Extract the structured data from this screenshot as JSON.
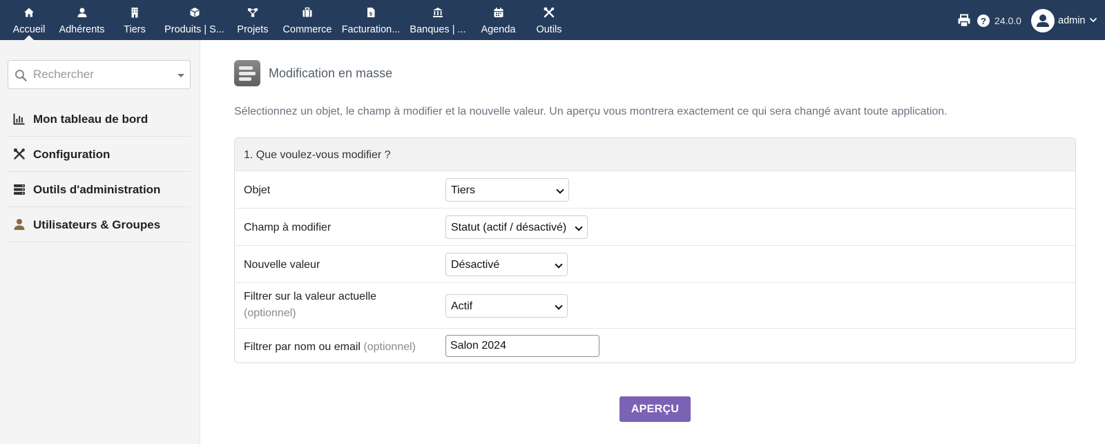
{
  "topnav": {
    "items": [
      {
        "label": "Accueil",
        "icon": "home-icon"
      },
      {
        "label": "Adhérents",
        "icon": "user-icon"
      },
      {
        "label": "Tiers",
        "icon": "building-icon"
      },
      {
        "label": "Produits | S...",
        "icon": "cube-icon"
      },
      {
        "label": "Projets",
        "icon": "project-icon"
      },
      {
        "label": "Commerce",
        "icon": "briefcase-icon"
      },
      {
        "label": "Facturation...",
        "icon": "invoice-icon"
      },
      {
        "label": "Banques | ...",
        "icon": "bank-icon"
      },
      {
        "label": "Agenda",
        "icon": "calendar-icon"
      },
      {
        "label": "Outils",
        "icon": "tools-icon"
      }
    ],
    "active": "Accueil",
    "version": "24.0.0",
    "user": "admin"
  },
  "sidebar": {
    "search_placeholder": "Rechercher",
    "items": [
      {
        "label": "Mon tableau de bord",
        "icon": "chart-icon"
      },
      {
        "label": "Configuration",
        "icon": "tools-icon"
      },
      {
        "label": "Outils d'administration",
        "icon": "server-icon"
      },
      {
        "label": "Utilisateurs & Groupes",
        "icon": "user-icon"
      }
    ]
  },
  "main": {
    "title": "Modification en masse",
    "description": "Sélectionnez un objet, le champ à modifier et la nouvelle valeur. Un aperçu vous montrera exactement ce qui sera changé avant toute application.",
    "section_title": "1. Que voulez-vous modifier ?",
    "fields": {
      "objet": {
        "label": "Objet",
        "value": "Tiers"
      },
      "champ": {
        "label": "Champ à modifier",
        "value": "Statut (actif / désactivé)"
      },
      "valeur": {
        "label": "Nouvelle valeur",
        "value": "Désactivé"
      },
      "filtre_valeur": {
        "label": "Filtrer sur la valeur actuelle",
        "optional": "(optionnel)",
        "value": "Actif"
      },
      "filtre_nom": {
        "label": "Filtrer par nom ou email",
        "optional": "(optionnel)",
        "value": "Salon 2024"
      }
    },
    "preview_button": "APERÇU"
  },
  "colors": {
    "topbar": "#263c5c",
    "button": "#7b62b5",
    "sidebar_bg": "#f4f4f4",
    "user_icon": "#8a6a43"
  }
}
